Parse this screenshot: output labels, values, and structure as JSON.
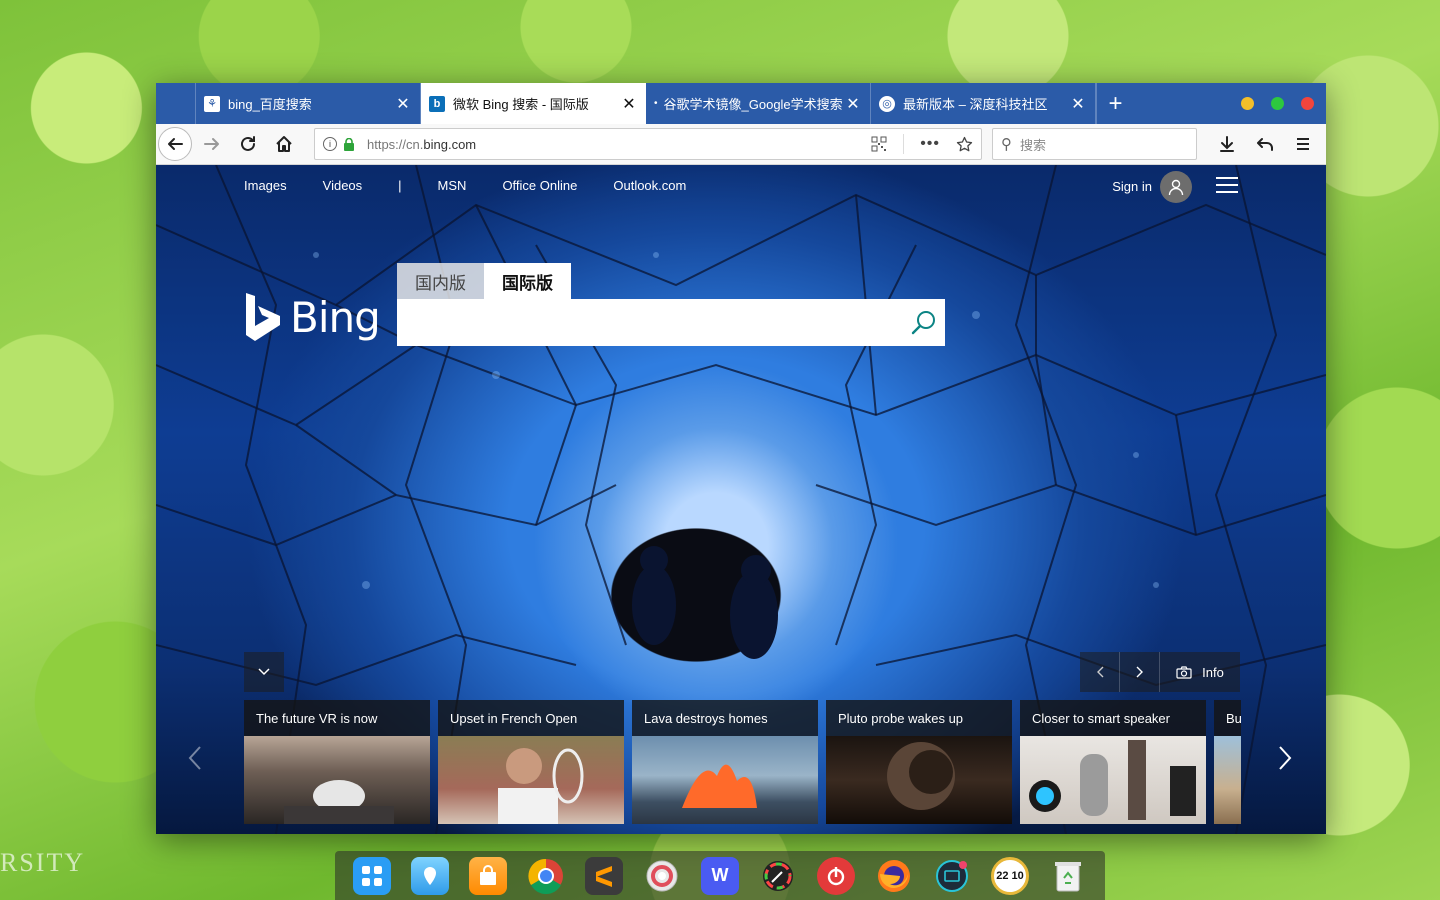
{
  "wallpaper_text": "RSITY",
  "tabs": [
    {
      "title": "bing_百度搜索",
      "favicon": "baidu-icon"
    },
    {
      "title": "微软 Bing 搜索 - 国际版",
      "favicon": "bing-icon"
    },
    {
      "title": "谷歌学术镜像_Google学术搜索",
      "favicon": "dot-icon"
    },
    {
      "title": "最新版本 – 深度科技社区",
      "favicon": "deepin-icon"
    }
  ],
  "navbar": {
    "url_scheme": "https://cn.",
    "url_host": "bing.com",
    "search_placeholder": "搜索"
  },
  "bing": {
    "top_links": [
      "Images",
      "Videos",
      "|",
      "MSN",
      "Office Online",
      "Outlook.com"
    ],
    "sign_in": "Sign in",
    "logo_text": "Bing",
    "search_tabs": [
      "国内版",
      "国际版"
    ],
    "search_value": "",
    "info_label": "Info",
    "cards": [
      {
        "caption": "The future VR is now"
      },
      {
        "caption": "Upset in French Open"
      },
      {
        "caption": "Lava destroys homes"
      },
      {
        "caption": "Pluto probe wakes up"
      },
      {
        "caption": "Closer to smart speaker"
      },
      {
        "caption": "Bu"
      }
    ]
  },
  "dock": [
    "launcher-icon",
    "file-manager-icon",
    "app-store-icon",
    "chrome-icon",
    "sublime-text-icon",
    "settings-icon",
    "wps-writer-icon",
    "color-picker-icon",
    "netease-music-icon",
    "firefox-icon",
    "screen-recorder-icon",
    "clock-icon",
    "trash-icon"
  ],
  "clock_text": "22 10",
  "colors": {
    "tabbar": "#2b5ba8",
    "traffic_yellow": "#f4bf2a",
    "traffic_green": "#2dc83f",
    "traffic_red": "#f2453d"
  }
}
